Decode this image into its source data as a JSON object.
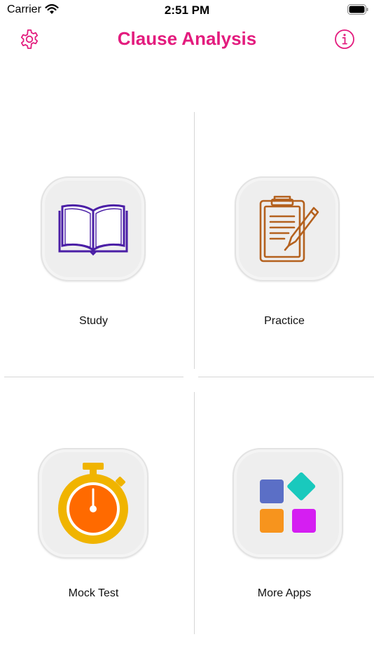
{
  "status_bar": {
    "carrier": "Carrier",
    "time": "2:51 PM"
  },
  "nav": {
    "title": "Clause Analysis",
    "settings_icon": "gear-icon",
    "info_icon": "info-icon"
  },
  "colors": {
    "accent": "#e31c7e",
    "book": "#4b1fa6",
    "clipboard": "#b4611e",
    "stopwatch_ring": "#f0b400",
    "stopwatch_face": "#ff6a00"
  },
  "tiles": [
    {
      "label": "Study",
      "icon": "book-icon"
    },
    {
      "label": "Practice",
      "icon": "clipboard-pen-icon"
    },
    {
      "label": "Mock Test",
      "icon": "stopwatch-icon"
    },
    {
      "label": "More Apps",
      "icon": "apps-grid-icon"
    }
  ]
}
